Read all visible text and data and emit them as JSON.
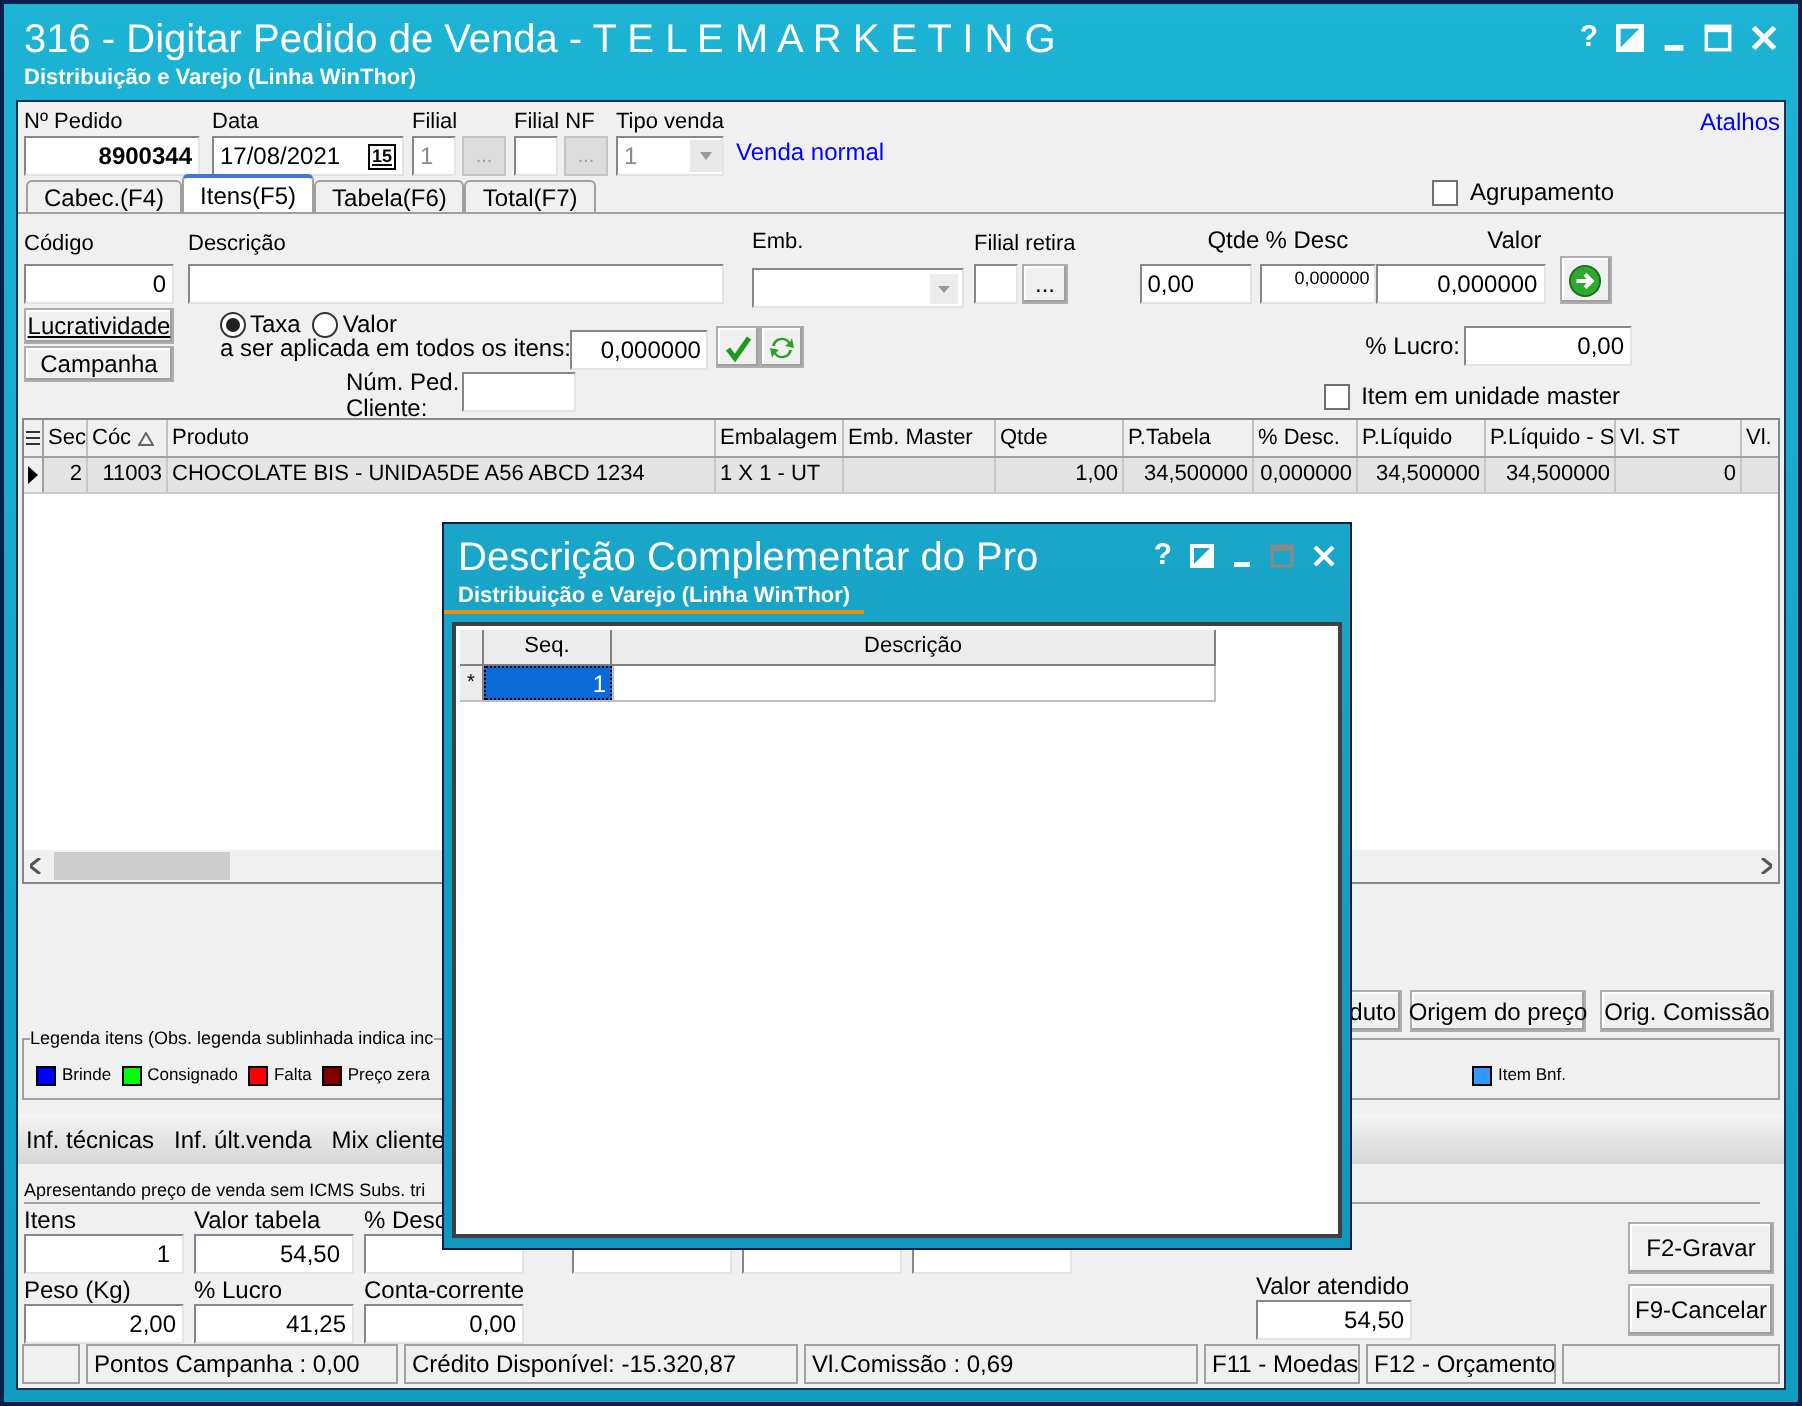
{
  "window": {
    "title": "316 - Digitar Pedido de Venda - T E L E M A R K E T I N G",
    "subtitle": "Distribuição e Varejo (Linha WinThor)",
    "help": "?"
  },
  "header": {
    "pedido": {
      "label": "Nº Pedido",
      "value": "8900344"
    },
    "data": {
      "label": "Data",
      "value": "17/08/2021",
      "calendar": "15"
    },
    "filial": {
      "label": "Filial",
      "value": "1",
      "button": "...",
      "disabled": true
    },
    "filial_nf": {
      "label": "Filial NF",
      "button": "...",
      "disabled": true
    },
    "tipo_venda": {
      "label": "Tipo venda",
      "value": "1"
    },
    "tipo_link": "Venda normal",
    "shortcut_link": "Atalhos"
  },
  "tabs": [
    {
      "label": "Cabec.(F4)",
      "selected": false
    },
    {
      "label": "Itens(F5)",
      "selected": true
    },
    {
      "label": "Tabela(F6)",
      "selected": false
    },
    {
      "label": "Total(F7)",
      "selected": false
    }
  ],
  "agrupamento": {
    "label": "Agrupamento",
    "checked": false
  },
  "item": {
    "codigo": {
      "label": "Código",
      "value": "0"
    },
    "descricao": {
      "label": "Descrição"
    },
    "emb": {
      "label": "Emb."
    },
    "filial_retira": {
      "label": "Filial retira",
      "button": "..."
    },
    "qtde": {
      "label": "Qtde",
      "value": "0,00"
    },
    "desc": {
      "label": "% Desc",
      "value": "0,000000"
    },
    "valor": {
      "label": "Valor",
      "value": "0,000000"
    },
    "buttons": [
      "Lucratividade",
      "Campanha"
    ],
    "radios": [
      {
        "label": "Taxa",
        "selected": true
      },
      {
        "label": "Valor",
        "selected": false
      }
    ],
    "apply_label": "a ser aplicada em todos os itens:",
    "apply_value": "0,000000",
    "num_ped_label": [
      "Núm. Ped.",
      "Cliente:"
    ],
    "lucro": {
      "label": "% Lucro:",
      "value": "0,00"
    },
    "unidade_master": {
      "label": "Item em unidade master",
      "checked": false
    }
  },
  "table": {
    "columns": [
      "Sec",
      "Cóc",
      "Produto",
      "Embalagem",
      "Emb. Master",
      "Qtde",
      "P.Tabela",
      "% Desc.",
      "P.Líquido",
      "P.Líquido - S",
      "Vl. ST",
      "Vl."
    ],
    "rows": [
      {
        "cells": [
          "2",
          "11003",
          "CHOCOLATE BIS - UNIDA5DE A56 ABCD 1234",
          "1 X 1 - UT",
          null,
          "1,00",
          "34,500000",
          "0,000000",
          "34,500000",
          "34,500000",
          "0"
        ],
        "selected": true
      }
    ]
  },
  "action_buttons": [
    "duto",
    "Origem do preço",
    "Orig. Comissão"
  ],
  "legend": {
    "title": "Legenda itens (Obs. legenda sublinhada indica inc",
    "items": [
      {
        "label": "Brinde",
        "color": "#0000ff"
      },
      {
        "label": "Consignado",
        "color": "#00ff00"
      },
      {
        "label": "Falta",
        "color": "#ff0000"
      },
      {
        "label": "Preço zera",
        "color": "#800000"
      },
      {
        "label": "Item Bnf.",
        "color": "#3399ff"
      }
    ]
  },
  "info_tabs": [
    "Inf. técnicas",
    "Inf. últ.venda",
    "Mix cliente"
  ],
  "totals": {
    "note": "Apresentando preço de venda sem ICMS Subs. tri",
    "row1": [
      {
        "label": "Itens",
        "value": "1"
      },
      {
        "label": "Valor tabela",
        "value": "54,50"
      },
      {
        "label": "% Desc"
      }
    ],
    "row2": [
      {
        "label": "Peso (Kg)",
        "value": "2,00"
      },
      {
        "label": "% Lucro",
        "value": "41,25"
      },
      {
        "label": "Conta-corrente",
        "value": "0,00"
      }
    ],
    "atendido": {
      "label": "Valor atendido",
      "value": "54,50"
    },
    "buttons": [
      "F2-Gravar",
      "F9-Cancelar"
    ]
  },
  "status_bar": [
    "Pontos Campanha : 0,00",
    "Crédito Disponível: -15.320,87",
    "Vl.Comissão : 0,69",
    "F11 - Moedas",
    "F12 - Orçamento"
  ],
  "dialog": {
    "title": "Descrição Complementar do Pro",
    "subtitle": "Distribuição e Varejo (Linha WinThor)",
    "help": "?",
    "columns": [
      "Seq.",
      "Descrição"
    ],
    "rows": [
      {
        "marker": "*",
        "seq": "1",
        "selected": true
      }
    ]
  }
}
